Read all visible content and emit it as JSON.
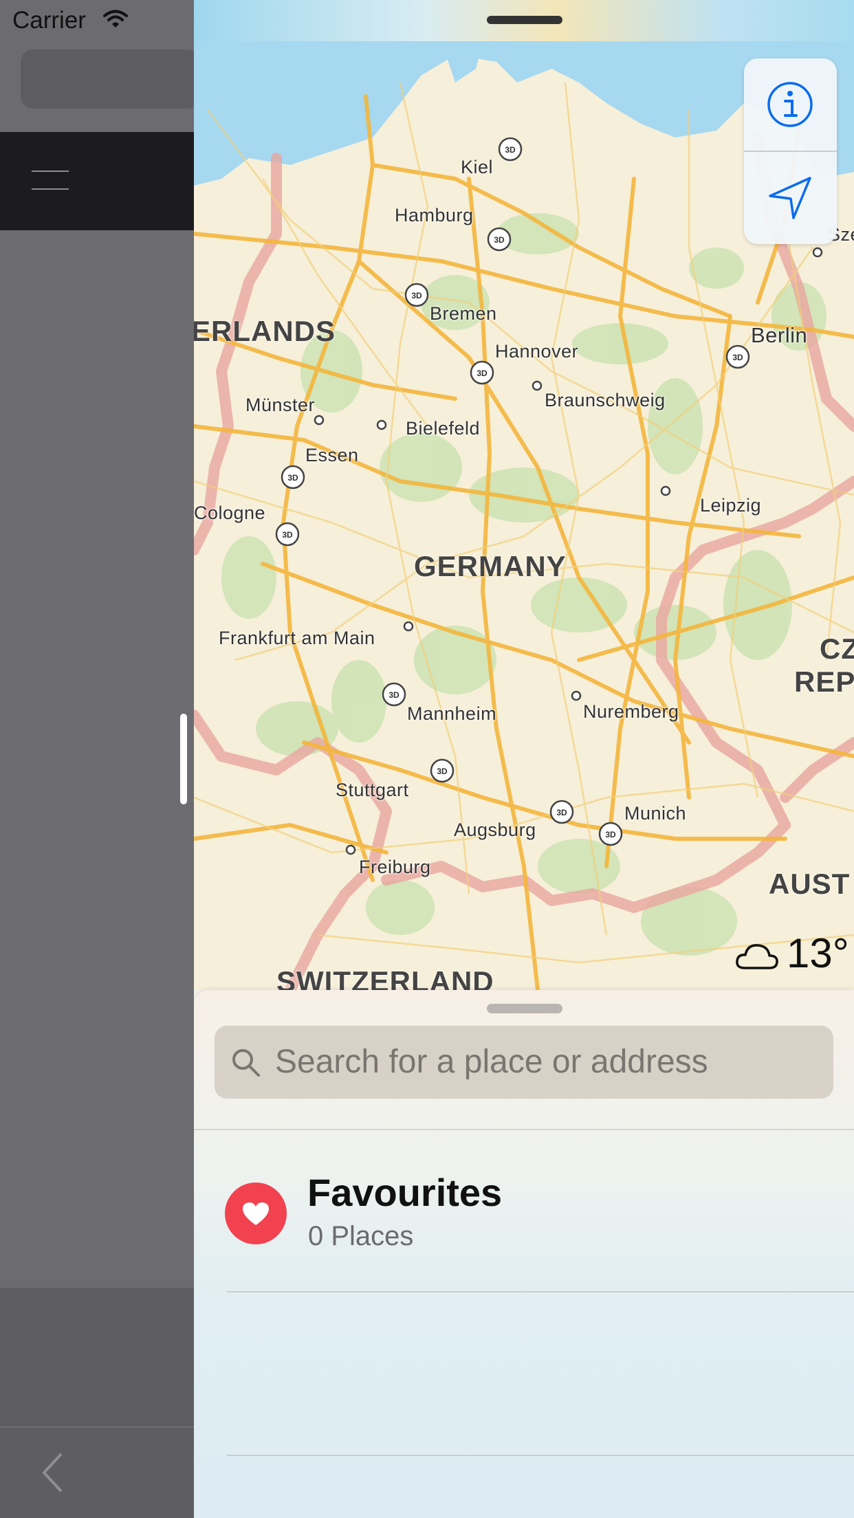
{
  "status_bar": {
    "carrier": "Carrier"
  },
  "map": {
    "country_labels": [
      "ERLANDS",
      "GERMANY",
      "CZ",
      "REP",
      "AUST",
      "SWITZERLAND"
    ],
    "cities": [
      "Kiel",
      "Hamburg",
      "Bremen",
      "Hannover",
      "Berlin",
      "Braunschweig",
      "Münster",
      "Bielefeld",
      "Essen",
      "Cologne",
      "Leipzig",
      "Frankfurt am Main",
      "Mannheim",
      "Nuremberg",
      "Stuttgart",
      "Augsburg",
      "Munich",
      "Freiburg",
      "Sze"
    ],
    "badge_3d": "3D",
    "weather": {
      "icon": "cloud-icon",
      "temperature": "13°"
    }
  },
  "controls": {
    "info_icon": "info-icon",
    "location_icon": "location-arrow-icon"
  },
  "sheet": {
    "search_placeholder": "Search for a place or address",
    "favourites": {
      "title": "Favourites",
      "count": "0 Places"
    }
  },
  "colors": {
    "accent": "#0a6cf0",
    "heart_badge": "#f2414f",
    "motorway": "#f4b63d",
    "border": "#e8a6a0",
    "forest": "#cfe3b5",
    "water": "#a6d8f0"
  }
}
